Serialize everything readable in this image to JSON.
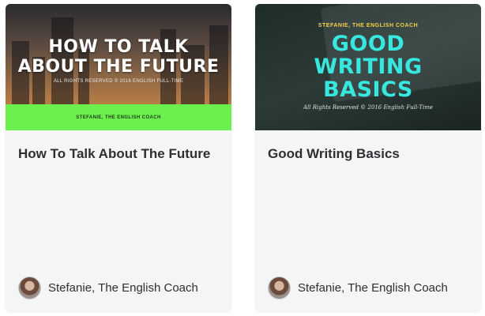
{
  "cards": [
    {
      "thumb": {
        "title_line1": "HOW TO TALK",
        "title_line2": "ABOUT THE FUTURE",
        "rights": "ALL RIGHTS RESERVED © 2016 ENGLISH FULL-TIME",
        "author": "STEFANIE, THE ENGLISH COACH",
        "band_color": "#6cf04e"
      },
      "title": "How To Talk About The Future",
      "author": "Stefanie, The English Coach"
    },
    {
      "thumb": {
        "author": "STEFANIE, THE ENGLISH COACH",
        "title_line1": "GOOD",
        "title_line2": "WRITING",
        "title_line3": "BASICS",
        "rights": "All Rights Reserved © 2016 English Full-Time",
        "title_color": "#36e8e0"
      },
      "title": "Good Writing Basics",
      "author": "Stefanie, The English Coach"
    }
  ]
}
